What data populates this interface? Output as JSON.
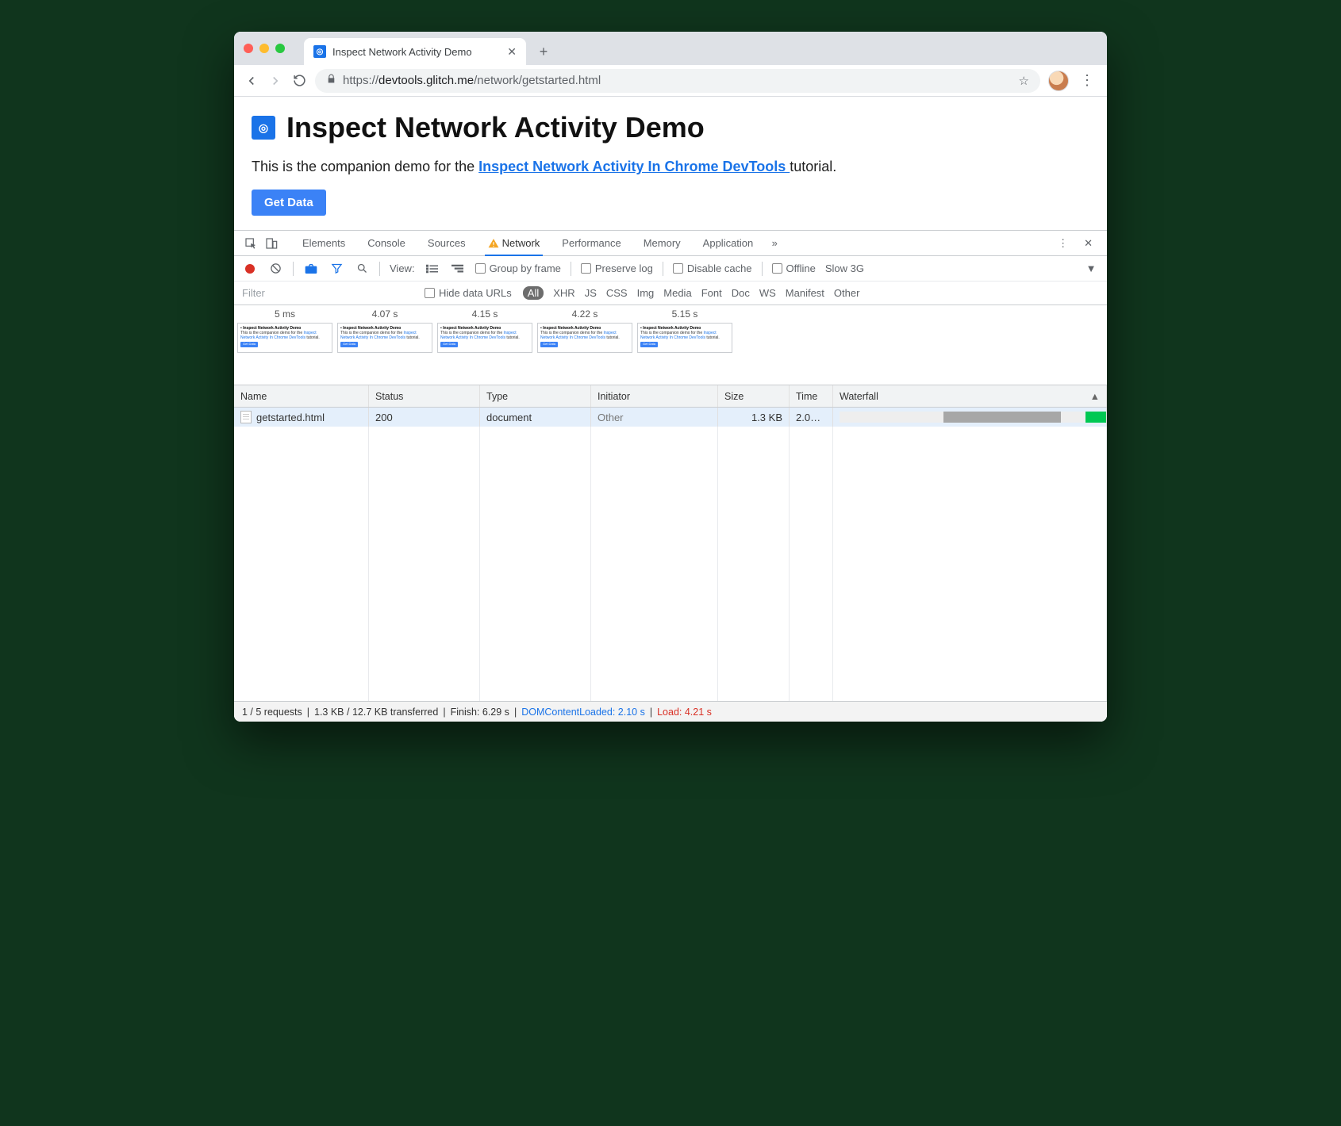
{
  "browser": {
    "tab_title": "Inspect Network Activity Demo",
    "url_prefix": "https://",
    "url_domain": "devtools.glitch.me",
    "url_path": "/network/getstarted.html"
  },
  "page": {
    "heading": "Inspect Network Activity Demo",
    "intro_prefix": "This is the companion demo for the ",
    "link_text": "Inspect Network Activity In Chrome DevTools ",
    "intro_suffix": "tutorial.",
    "button": "Get Data"
  },
  "devtools": {
    "tabs": {
      "t1": "Elements",
      "t2": "Console",
      "t3": "Sources",
      "t4": "Network",
      "t5": "Performance",
      "t6": "Memory",
      "t7": "Application"
    },
    "bar2": {
      "view": "View:",
      "group": "Group by frame",
      "preserve": "Preserve log",
      "disable": "Disable cache",
      "offline": "Offline",
      "throttle": "Slow 3G"
    },
    "filter_placeholder": "Filter",
    "hide": "Hide data URLs",
    "types": {
      "all": "All",
      "xhr": "XHR",
      "js": "JS",
      "css": "CSS",
      "img": "Img",
      "media": "Media",
      "font": "Font",
      "doc": "Doc",
      "ws": "WS",
      "manifest": "Manifest",
      "other": "Other"
    },
    "filmstrip": [
      "5 ms",
      "4.07 s",
      "4.15 s",
      "4.22 s",
      "5.15 s"
    ],
    "columns": {
      "name": "Name",
      "status": "Status",
      "type": "Type",
      "initiator": "Initiator",
      "size": "Size",
      "time": "Time",
      "waterfall": "Waterfall"
    },
    "rows": [
      {
        "name": "getstarted.html",
        "status": "200",
        "type": "document",
        "initiator": "Other",
        "size": "1.3 KB",
        "time": "2.0…"
      }
    ],
    "status": {
      "reqs": "1 / 5 requests",
      "xfer": "1.3 KB / 12.7 KB transferred",
      "finish": "Finish: 6.29 s",
      "dcl": "DOMContentLoaded: 2.10 s",
      "load": "Load: 4.21 s"
    }
  }
}
